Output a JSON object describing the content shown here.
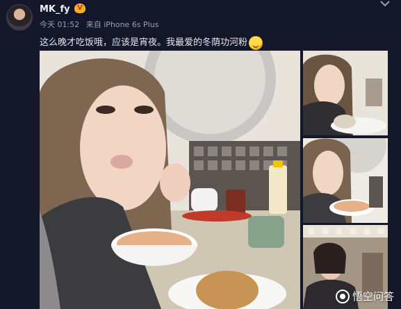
{
  "user": {
    "name": "MK_fy",
    "badge": "V"
  },
  "meta": {
    "time": "今天 01:52",
    "source": "来自 iPhone 6s Plus"
  },
  "post": {
    "text": "这么晚才吃饭哦，应该是宵夜。我最爱的冬荫功河粉"
  },
  "watermark": {
    "text": "悟空问答"
  },
  "icons": {
    "expand": "chevron-down-icon",
    "emoji": "grin-emoji-icon",
    "badge": "vip-badge-icon",
    "watermark": "wukong-logo-icon"
  }
}
